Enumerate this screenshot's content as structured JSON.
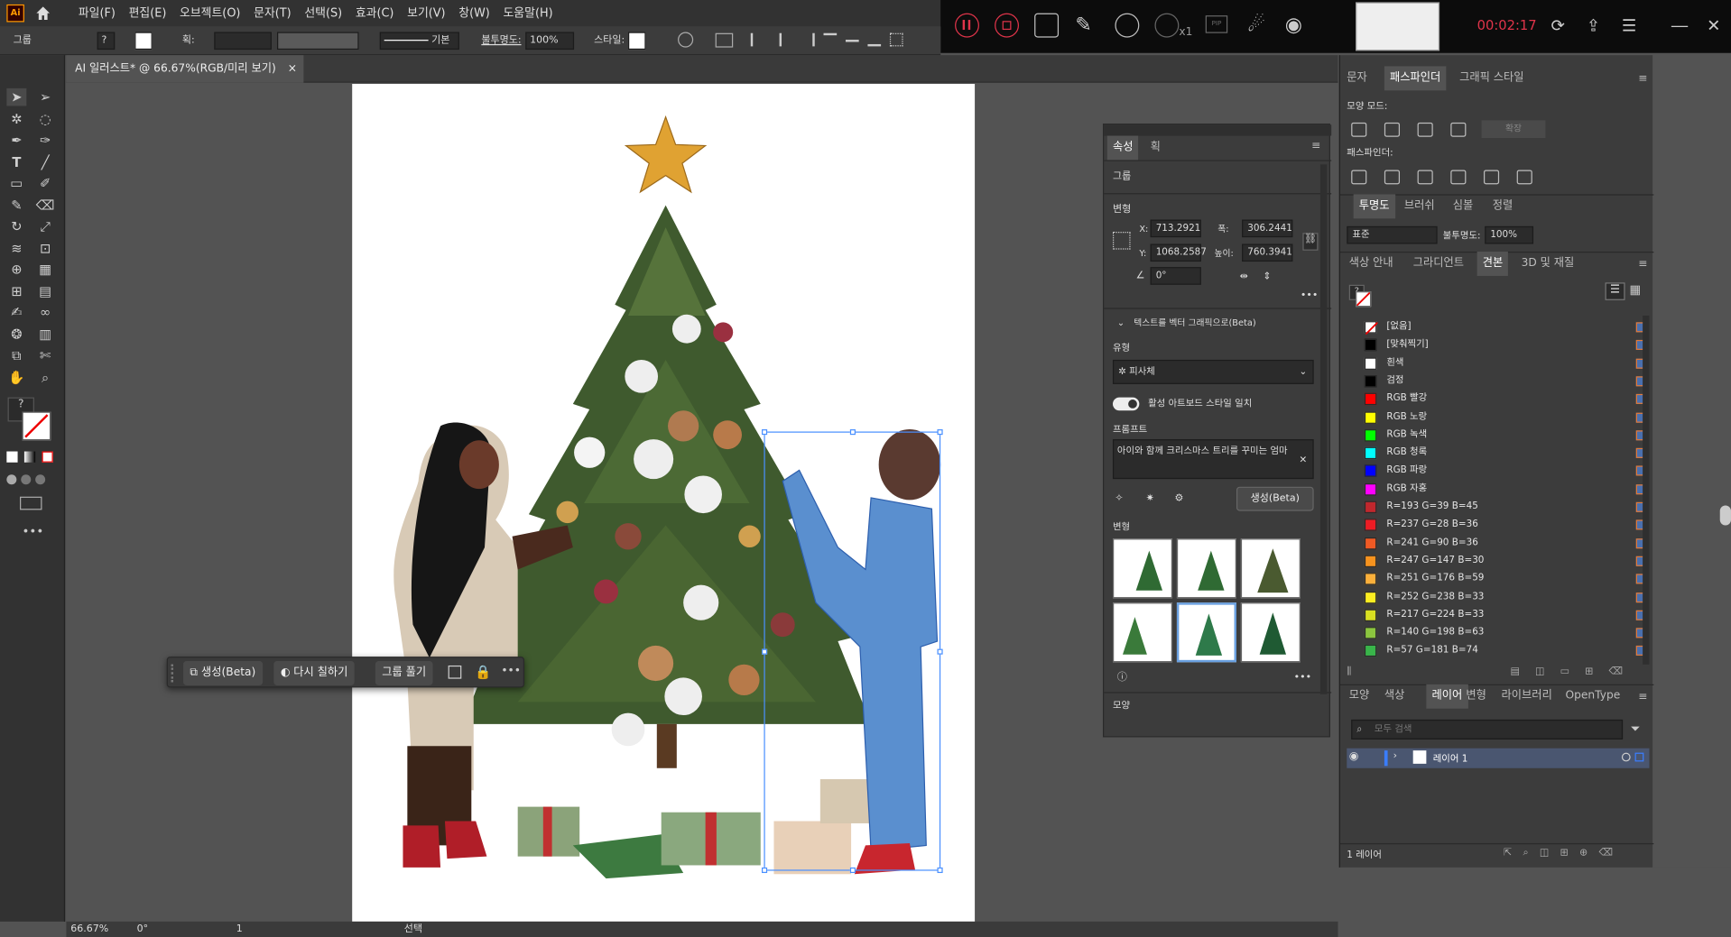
{
  "menubar": {
    "items": [
      "파일(F)",
      "편집(E)",
      "오브젝트(O)",
      "문자(T)",
      "선택(S)",
      "효과(C)",
      "보기(V)",
      "창(W)",
      "도움말(H)"
    ],
    "logo": "Ai"
  },
  "recorder": {
    "zoom": "x1",
    "pip": "PIP",
    "time": "00:02:17"
  },
  "control": {
    "group_label": "그룹",
    "stroke_label": "획:",
    "basic_label": "기본",
    "opacity_label": "불투명도:",
    "opacity_value": "100%",
    "style_label": "스타일:"
  },
  "document": {
    "tab_title": "AI 일러스트* @ 66.67%(RGB/미리 보기)",
    "close": "×"
  },
  "context_bar": {
    "generate": "생성(Beta)",
    "recolor": "다시 칠하기",
    "ungroup": "그룹 풀기",
    "more": "•••"
  },
  "properties": {
    "tabs": [
      "속성",
      "획"
    ],
    "selection": "그룹",
    "transform_label": "변형",
    "x_label": "X:",
    "x": "713.2921",
    "y_label": "Y:",
    "y": "1068.2587",
    "w_label": "폭:",
    "w": "306.2441",
    "h_label": "높이:",
    "h": "760.3941",
    "angle": "0°",
    "text_to_vector": "텍스트를 벡터 그래픽으로(Beta)",
    "type_label": "유형",
    "type_value": "피사체",
    "match_style": "활성 아트보드 스타일 일치",
    "prompt_label": "프롬프트",
    "prompt_text": "아이와 함께 크리스마스 트리를 꾸미는 엄마",
    "generate_button": "생성(Beta)",
    "variations_label": "변형",
    "appearance_label": "모양",
    "more": "•••"
  },
  "right": {
    "top_tabs": [
      "문자",
      "패스파인더",
      "그래픽 스타일"
    ],
    "shape_modes": "모양 모드:",
    "expand": "확장",
    "pathfinder": "패스파인더:",
    "mid_tabs": [
      "투명도",
      "브러쉬",
      "심볼",
      "정렬"
    ],
    "blend": "표준",
    "opacity_label": "불투명도:",
    "opacity_value": "100%",
    "swatch_tabs": [
      "색상 안내",
      "그라디언트",
      "견본",
      "3D 및 재질"
    ],
    "swatches": [
      {
        "name": "[없음]",
        "color": "none"
      },
      {
        "name": "[맞춰찍기]",
        "color": "#000000"
      },
      {
        "name": "흰색",
        "color": "#ffffff"
      },
      {
        "name": "검정",
        "color": "#000000"
      },
      {
        "name": "RGB 빨강",
        "color": "#ff0000"
      },
      {
        "name": "RGB 노랑",
        "color": "#ffff00"
      },
      {
        "name": "RGB 녹색",
        "color": "#00ff00"
      },
      {
        "name": "RGB 청록",
        "color": "#00ffff"
      },
      {
        "name": "RGB 파랑",
        "color": "#0000ff"
      },
      {
        "name": "RGB 자홍",
        "color": "#ff00ff"
      },
      {
        "name": "R=193 G=39 B=45",
        "color": "#c1272d"
      },
      {
        "name": "R=237 G=28 B=36",
        "color": "#ed1c24"
      },
      {
        "name": "R=241 G=90 B=36",
        "color": "#f15a24"
      },
      {
        "name": "R=247 G=147 B=30",
        "color": "#f7931e"
      },
      {
        "name": "R=251 G=176 B=59",
        "color": "#fbb03b"
      },
      {
        "name": "R=252 G=238 B=33",
        "color": "#fcee21"
      },
      {
        "name": "R=217 G=224 B=33",
        "color": "#d9e021"
      },
      {
        "name": "R=140 G=198 B=63",
        "color": "#8cc63f"
      },
      {
        "name": "R=57 G=181 B=74",
        "color": "#39b54a"
      }
    ],
    "layer_tabs": [
      "모양",
      "색상",
      "레이어",
      "변형",
      "라이브러리",
      "OpenType"
    ],
    "layer_search_placeholder": "모두 검색",
    "layer_name": "레이어 1",
    "layer_count": "1 레이어"
  },
  "status": {
    "zoom": "66.67%",
    "angle": "0°",
    "artboard": "1",
    "mode": "선택"
  }
}
